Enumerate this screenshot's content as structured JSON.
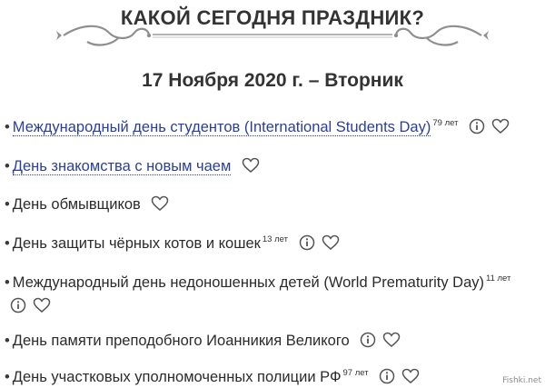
{
  "header": {
    "title": "КАКОЙ СЕГОДНЯ ПРАЗДНИК?",
    "date": "17 Ноября 2020 г. – Вторник"
  },
  "holidays": [
    {
      "name": "Международный день студентов (International Students Day)",
      "age": "79 лет",
      "is_link": true,
      "has_info": true
    },
    {
      "name": "День знакомства с новым чаем",
      "age": "",
      "is_link": true,
      "has_info": false
    },
    {
      "name": "День обмывщиков",
      "age": "",
      "is_link": false,
      "has_info": false
    },
    {
      "name": "День защиты чёрных котов и кошек",
      "age": "13 лет",
      "is_link": false,
      "has_info": true
    },
    {
      "name": "Международный день недоношенных детей (World Prematurity Day)",
      "age": "11 лет",
      "is_link": false,
      "has_info": true
    },
    {
      "name": "День памяти преподобного Иоанникия Великого",
      "age": "",
      "is_link": false,
      "has_info": true
    },
    {
      "name": "День участковых уполномоченных полиции РФ",
      "age": "97 лет",
      "is_link": false,
      "has_info": true
    }
  ],
  "icons": {
    "info": "info-circle-icon",
    "favorite": "heart-outline-icon"
  },
  "watermark": "Fishki.net",
  "colors": {
    "link": "#2a3f9d",
    "text": "#2b2b2b",
    "icon": "#555555"
  }
}
